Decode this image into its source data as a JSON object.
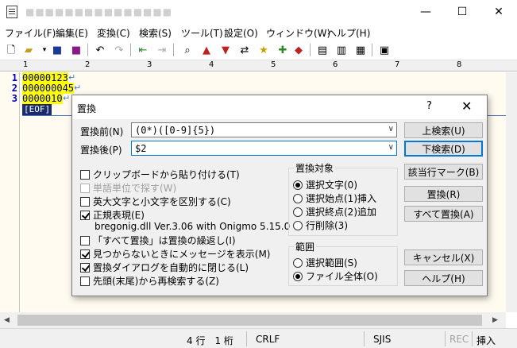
{
  "window": {
    "title": "■■■■■■■■■■■■■■■",
    "controls": {
      "minimize": "—",
      "maximize": "☐",
      "close": "✕"
    }
  },
  "menu": [
    "ファイル(F)",
    "編集(E)",
    "変換(C)",
    "検索(S)",
    "ツール(T)",
    "設定(O)",
    "ウィンドウ(W)",
    "ヘルプ(H)"
  ],
  "ruler": [
    "1",
    "2",
    "3",
    "4",
    "5",
    "6",
    "7",
    "8"
  ],
  "editor": {
    "lines": [
      {
        "num": "1",
        "text": "00000123"
      },
      {
        "num": "2",
        "text": "000000045"
      },
      {
        "num": "3",
        "text": "0000010"
      }
    ],
    "eol_mark": "↵",
    "eof_mark": "[EOF]"
  },
  "status": {
    "position": "4 行　1 桁",
    "line_ending": "CRLF",
    "encoding": "SJIS",
    "rec": "REC",
    "mode": "挿入"
  },
  "dialog": {
    "title": "置換",
    "help_glyph": "?",
    "close_glyph": "✕",
    "search_label": "置換前(N)",
    "search_value": "(0*)([0-9]{5})",
    "replace_label": "置換後(P)",
    "replace_value": "$2",
    "buttons": {
      "search_up": "上検索(U)",
      "search_down": "下検索(D)",
      "mark": "該当行マーク(B)",
      "replace": "置換(R)",
      "replace_all": "すべて置換(A)",
      "cancel": "キャンセル(X)",
      "help": "ヘルプ(H)"
    },
    "options": {
      "paste_clipboard": {
        "label": "クリップボードから貼り付ける(T)",
        "checked": false
      },
      "word_unit": {
        "label": "単語単位で探す(W)",
        "checked": false
      },
      "match_case": {
        "label": "英大文字と小文字を区別する(C)",
        "checked": false
      },
      "regex": {
        "label": "正規表現(E)",
        "checked": true
      },
      "regex_lib": "bregonig.dll Ver.3.06 with Onigmo 5.15.0",
      "repeat_replace_all": {
        "label": "「すべて置換」は置換の繰返し(I)",
        "checked": false
      },
      "show_not_found": {
        "label": "見つからないときにメッセージを表示(M)",
        "checked": true
      },
      "auto_close": {
        "label": "置換ダイアログを自動的に閉じる(L)",
        "checked": true
      },
      "wrap_search": {
        "label": "先頭(末尾)から再検索する(Z)",
        "checked": false
      }
    },
    "target_group": {
      "label": "置換対象",
      "options": [
        {
          "label": "選択文字(0)",
          "selected": true
        },
        {
          "label": "選択始点(1)挿入",
          "selected": false
        },
        {
          "label": "選択終点(2)追加",
          "selected": false
        },
        {
          "label": "行削除(3)",
          "selected": false
        }
      ]
    },
    "scope_group": {
      "label": "範囲",
      "options": [
        {
          "label": "選択範囲(S)",
          "selected": false
        },
        {
          "label": "ファイル全体(O)",
          "selected": true
        }
      ]
    }
  }
}
